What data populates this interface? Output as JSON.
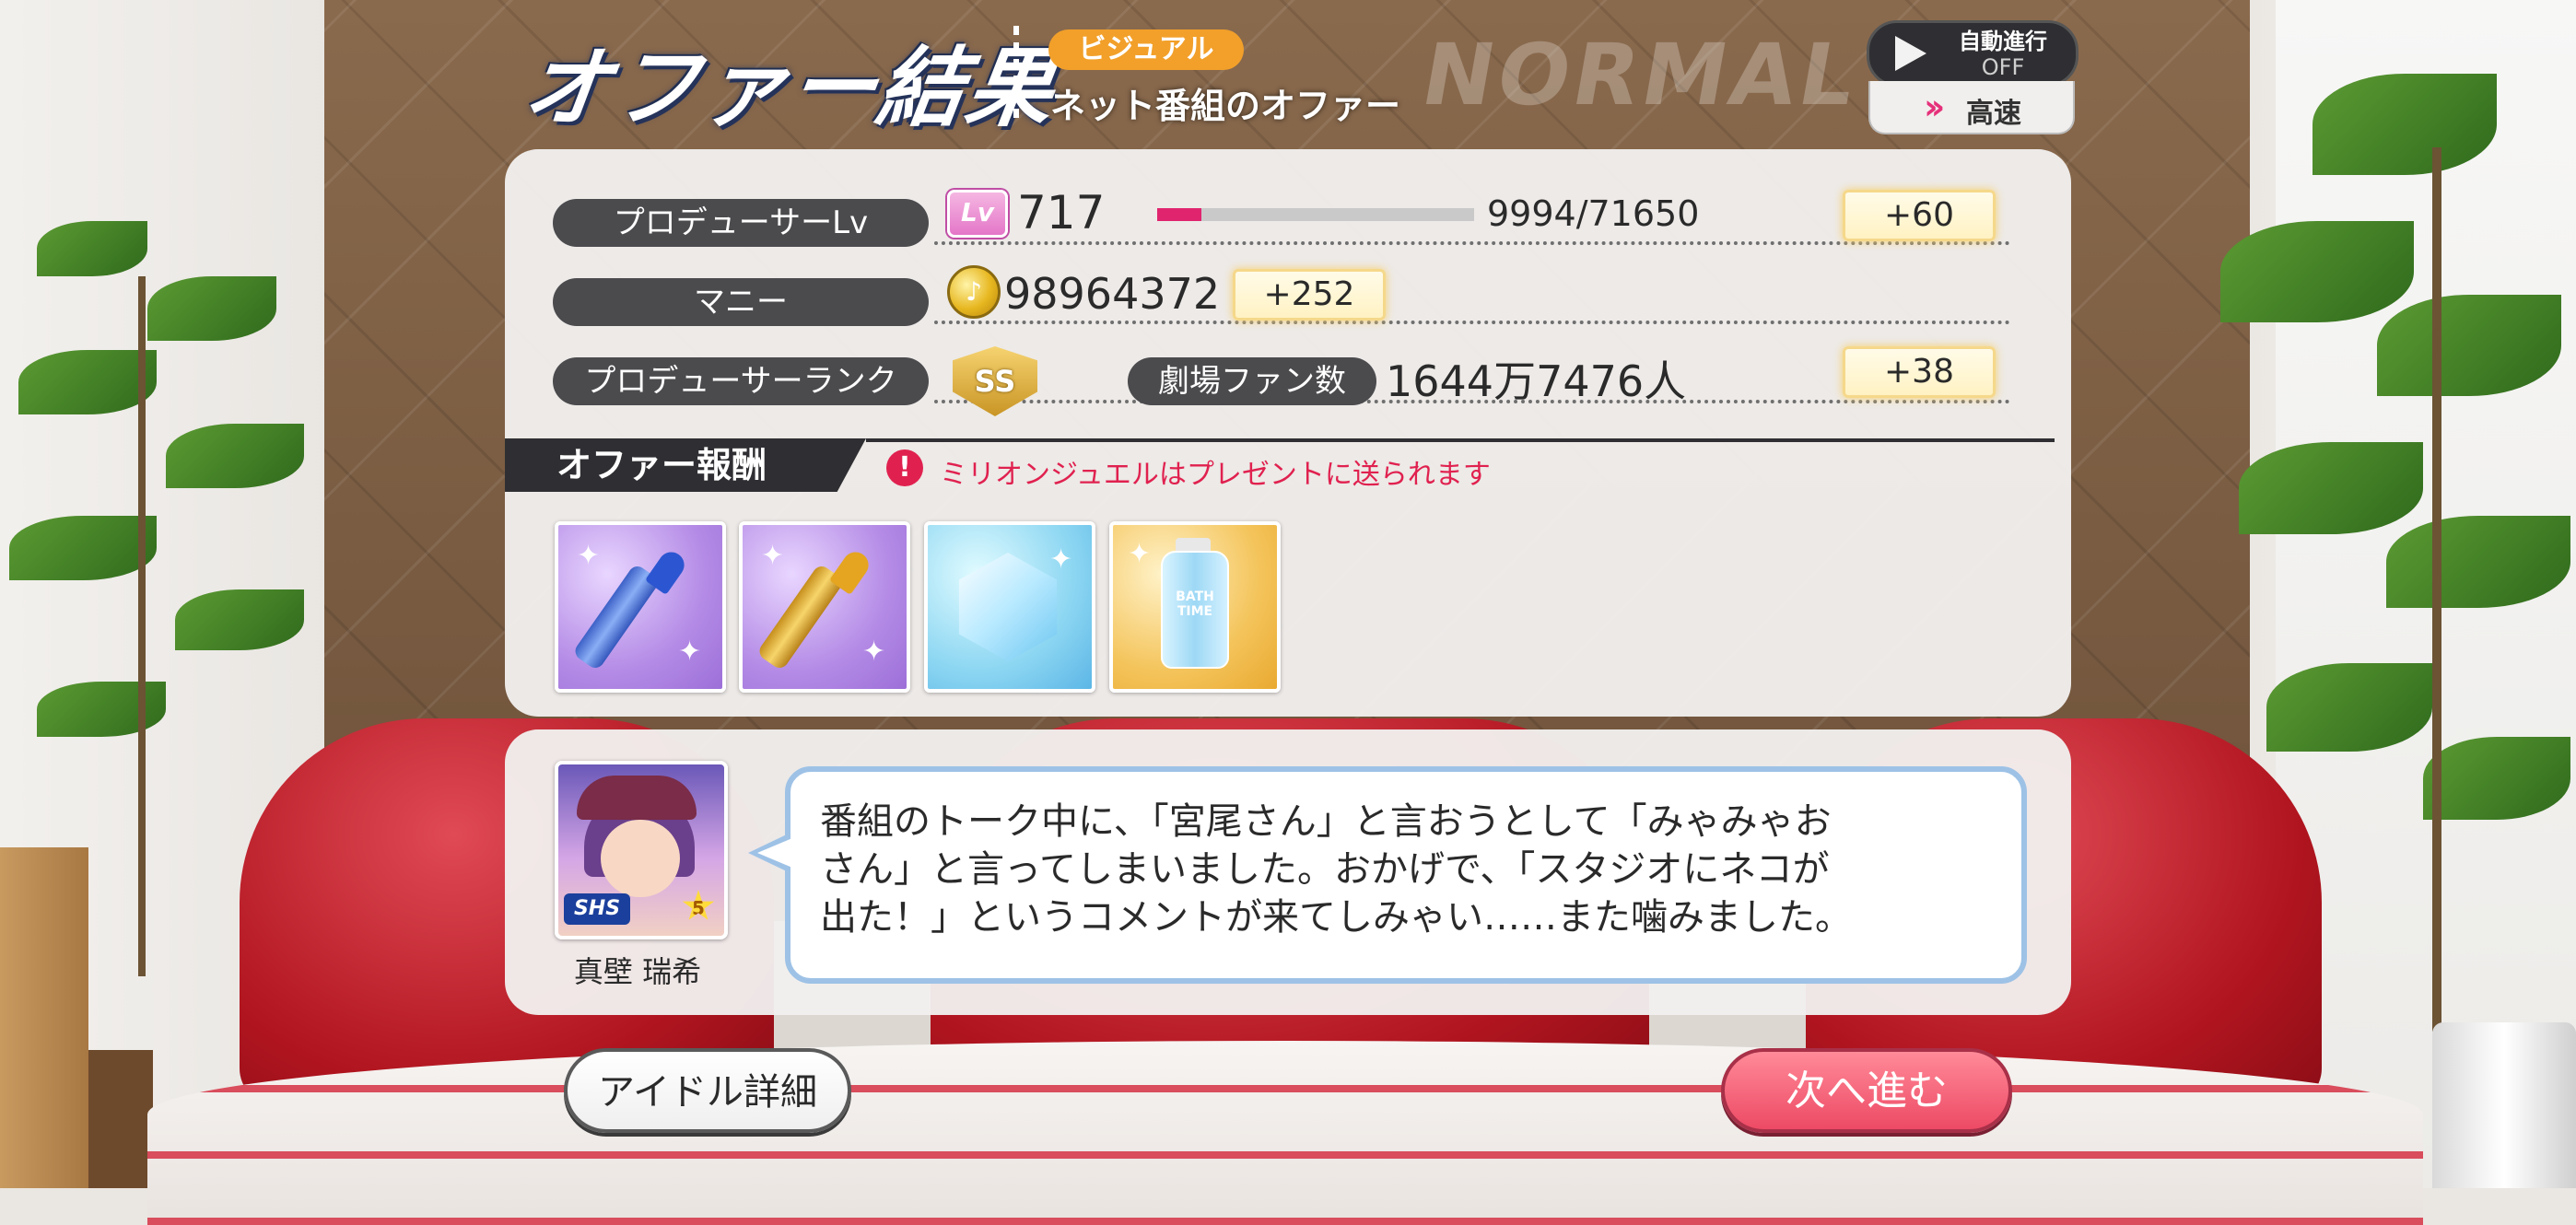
{
  "header": {
    "title": "オファー結果",
    "category": "ビジュアル",
    "offer_name": "ネット番組のオファー",
    "difficulty": "NORMAL",
    "auto_advance": {
      "label": "自動進行",
      "state": "OFF"
    },
    "speed": {
      "label": "高速",
      "icon": "double-chevron-right-icon"
    }
  },
  "producer": {
    "level": {
      "label": "プロデューサーLv",
      "icon_text": "Lv",
      "value": "717",
      "exp_text": "9994/71650",
      "exp_progress": 0.139,
      "gain": "+60"
    },
    "money": {
      "label": "マニー",
      "icon": "coin-icon",
      "icon_text": "♪",
      "value": "98964372",
      "gain": "+252"
    },
    "rank": {
      "label": "プロデューサーランク",
      "badge_text": "SS"
    },
    "fans": {
      "label": "劇場ファン数",
      "value": "1644万7476人",
      "gain": "+38"
    }
  },
  "rewards": {
    "header": "オファー報酬",
    "notice_icon": "!",
    "notice": "ミリオンジュエルはプレゼントに送られます",
    "items": [
      {
        "name": "blue-lipstick",
        "frame_color": "purple"
      },
      {
        "name": "gold-lipstick",
        "frame_color": "purple"
      },
      {
        "name": "crystal-gem",
        "frame_color": "cyan"
      },
      {
        "name": "bath-time-bottle",
        "frame_color": "gold",
        "label": "BATH TIME"
      }
    ]
  },
  "dialog": {
    "idol_name": "真壁 瑞希",
    "idol_type": "SHS",
    "idol_rarity": "5",
    "text": "番組のトーク中に、「宮尾さん」と言おうとして「みゃみゃお\nさん」と言ってしまいました。おかげで、「スタジオにネコが\n出た！」というコメントが来てしみゃい……また噛みました。"
  },
  "buttons": {
    "idol_detail": "アイドル詳細",
    "next": "次へ進む"
  },
  "colors": {
    "accent_pink": "#e0246e",
    "next_button": "#ed4a65",
    "category_badge": "#f2a02a",
    "notice_red": "#e0214f"
  }
}
